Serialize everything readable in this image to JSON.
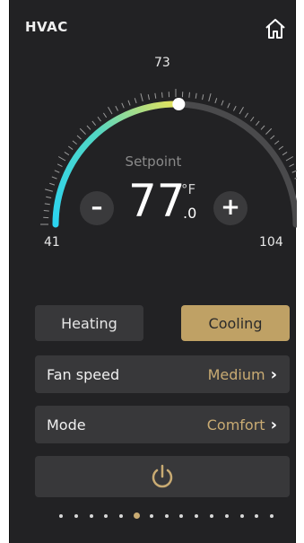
{
  "header": {
    "title": "HVAC",
    "home_icon": "home-icon"
  },
  "thermostat": {
    "min_label": "41",
    "max_label": "104",
    "current_label": "73",
    "current_value": 73,
    "min_value": 41,
    "max_value": 104,
    "setpoint_label": "Setpoint",
    "temp_whole": "77",
    "temp_unit": "°F",
    "temp_decimal": ".0",
    "decrease_label": "–",
    "increase_label": "+",
    "colors": {
      "arc_start": "#2bd4f0",
      "arc_mid": "#4fd8c8",
      "arc_end": "#e8e25a",
      "track": "#4a4a4c"
    }
  },
  "modes": {
    "heating_label": "Heating",
    "cooling_label": "Cooling",
    "selected": "Cooling",
    "accent": "#bfa165"
  },
  "fan": {
    "label": "Fan speed",
    "value": "Medium"
  },
  "mode": {
    "label": "Mode",
    "value": "Comfort"
  },
  "power": {
    "icon": "power-icon"
  },
  "pager": {
    "total": 15,
    "current": 5
  }
}
